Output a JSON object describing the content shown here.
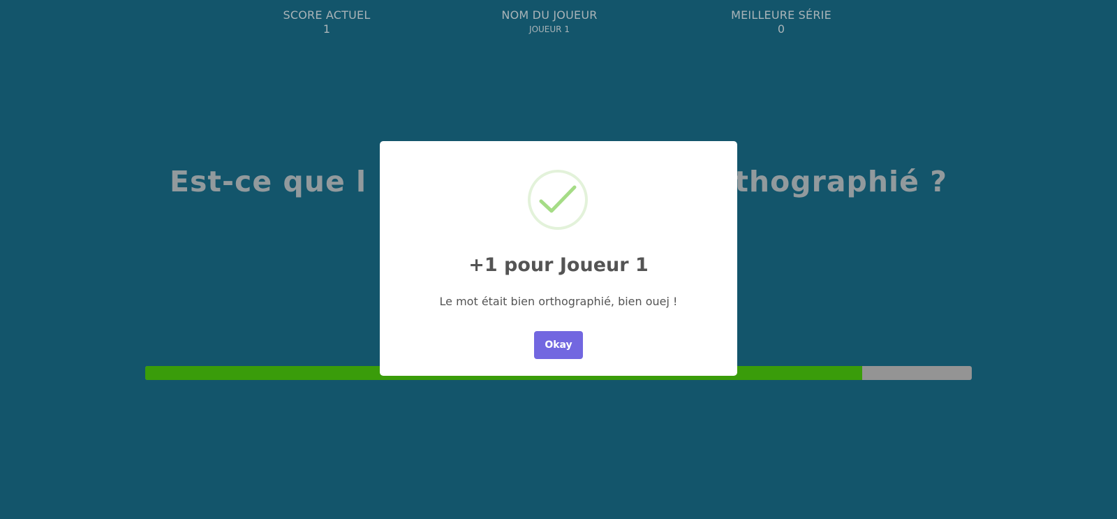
{
  "stats": {
    "score": {
      "label": "SCORE ACTUEL",
      "value": "1"
    },
    "player": {
      "label": "NOM DU JOUEUR",
      "value": "JOUEUR 1"
    },
    "best_streak": {
      "label": "MEILLEURE SÉRIE",
      "value": "0"
    }
  },
  "question": {
    "text_left": "Est-ce que l",
    "text_right": "rthographié ?"
  },
  "timer": {
    "progress_fraction": 0.867,
    "fill_color": "#3a9c0a",
    "track_color": "#949494"
  },
  "modal": {
    "icon": "checkmark-icon",
    "icon_color": "#a5dc86",
    "title": "+1 pour Joueur 1",
    "text": "Le mot était bien orthographié, bien ouej !",
    "button_label": "Okay",
    "button_color": "#7267e0"
  },
  "colors": {
    "background": "#13556b",
    "muted_text": "#aab4b8"
  }
}
